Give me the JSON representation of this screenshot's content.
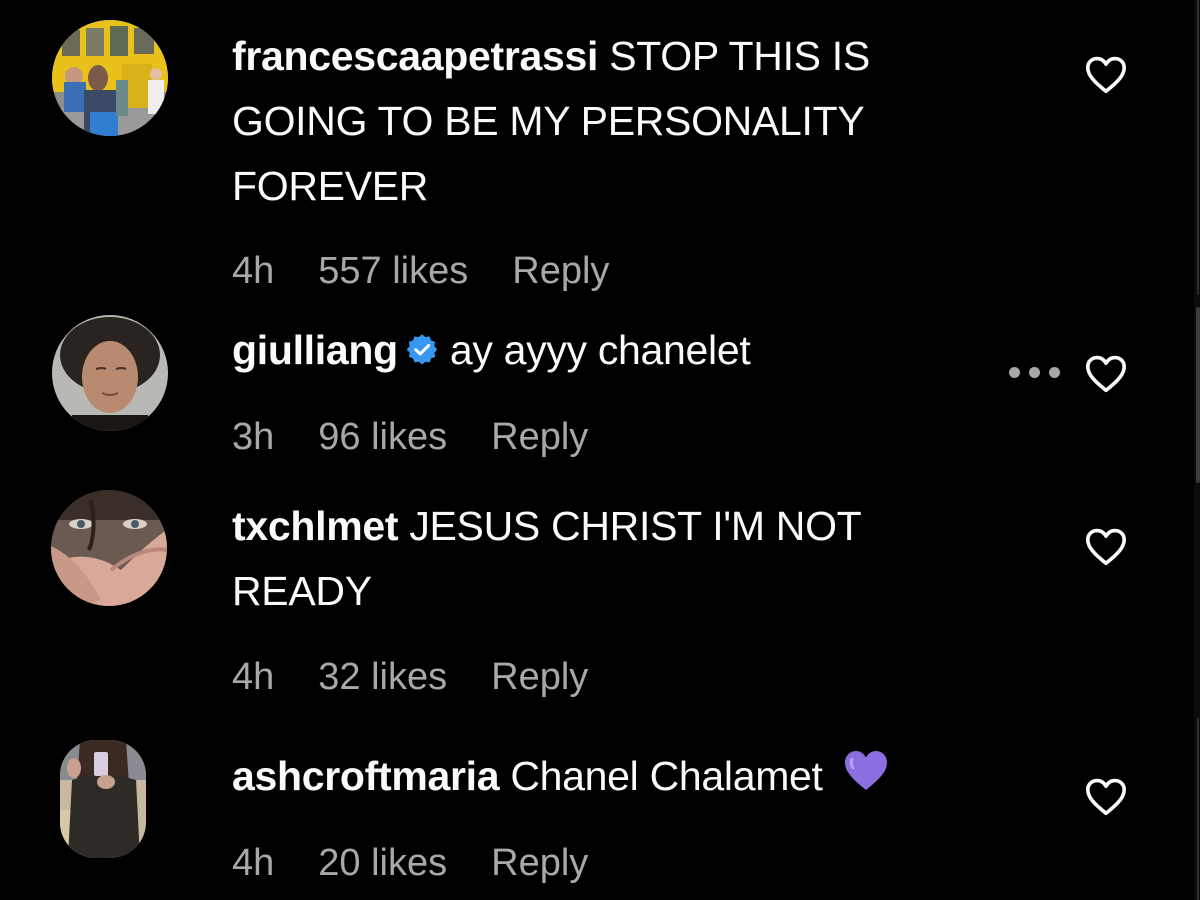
{
  "comments": [
    {
      "username": "francescaapetrassi",
      "text": "STOP THIS IS GOING TO BE MY PERSONALITY FOREVER",
      "time": "4h",
      "likes": "557 likes",
      "reply_label": "Reply",
      "verified": false,
      "avatar": "avatar-yellow-storefront",
      "like_icon": "heart-outline-icon"
    },
    {
      "username": "giulliang",
      "text": "ay ayyy chanelet",
      "time": "3h",
      "likes": "96 likes",
      "reply_label": "Reply",
      "verified": true,
      "avatar": "avatar-young-man-curly-hair",
      "like_icon": "heart-outline-icon",
      "more_icon": "more-options-icon"
    },
    {
      "username": "txchlmet",
      "text": "JESUS CHRIST I'M NOT READY",
      "time": "4h",
      "likes": "32 likes",
      "reply_label": "Reply",
      "verified": false,
      "avatar": "avatar-hand-over-face",
      "like_icon": "heart-outline-icon"
    },
    {
      "username": "ashcroftmaria",
      "text": "Chanel Chalamet",
      "emoji": "purple-heart",
      "time": "4h",
      "likes": "20 likes",
      "reply_label": "Reply",
      "verified": false,
      "avatar": "avatar-mirror-selfie",
      "like_icon": "heart-outline-icon"
    }
  ],
  "colors": {
    "background": "#000000",
    "primary_text": "#fafafa",
    "secondary_text": "#a8a8a8",
    "verified_blue": "#3897f0",
    "purple_heart": "#8b6fe0"
  }
}
